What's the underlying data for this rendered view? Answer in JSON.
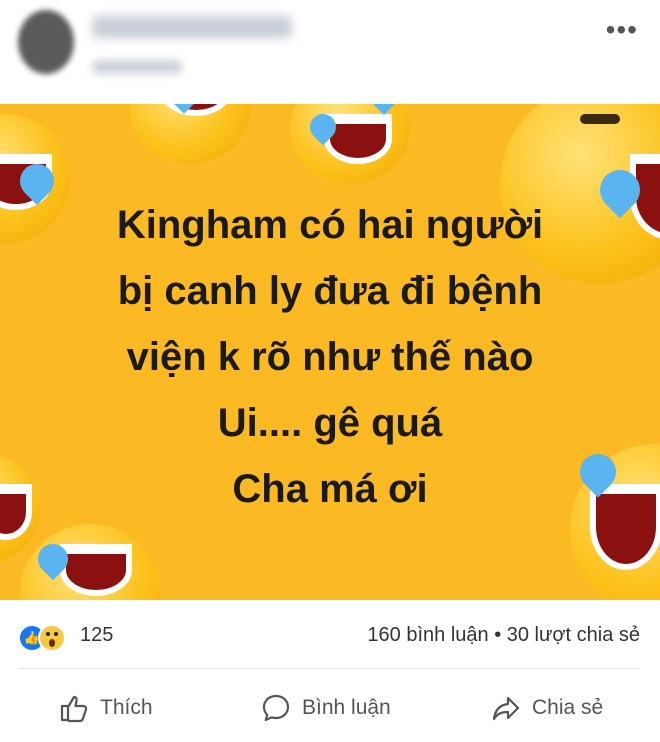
{
  "header": {
    "menu_icon": "more-dots-icon"
  },
  "post": {
    "text_lines": [
      "Kingham có hai người",
      "bị canh ly đưa đi bệnh",
      "viện k rõ như thế nào",
      "Ui.... gê quá",
      "Cha má ơi"
    ],
    "image_background": "#fbba24"
  },
  "stats": {
    "reaction_icons": [
      "like-icon",
      "wow-icon"
    ],
    "reaction_count": "125",
    "comments_shares": "160 bình luận • 30 lượt chia sẻ"
  },
  "actions": {
    "like_label": "Thích",
    "comment_label": "Bình luận",
    "share_label": "Chia sẻ"
  },
  "colors": {
    "like_blue": "#1877f2",
    "icon_gray": "#555555"
  }
}
